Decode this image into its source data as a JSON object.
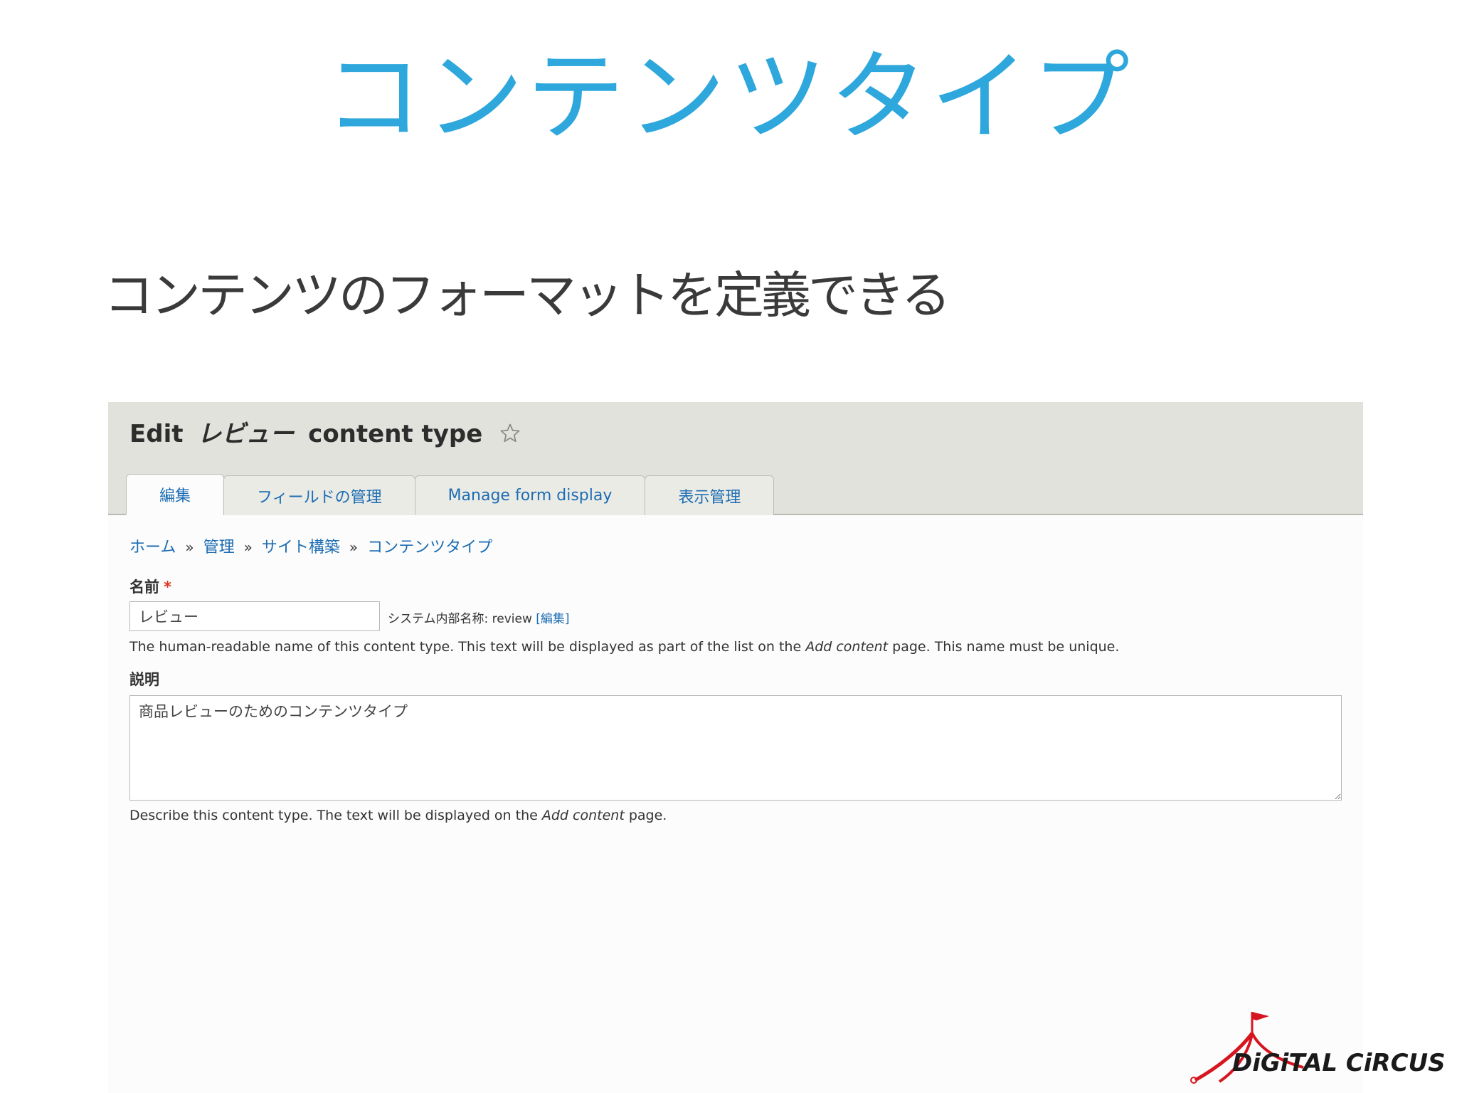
{
  "slide": {
    "title": "コンテンツタイプ",
    "subtitle": "コンテンツのフォーマットを定義できる"
  },
  "screenshot": {
    "page_title_prefix": "Edit",
    "page_title_name": "レビュー",
    "page_title_suffix": "content type",
    "tabs": [
      {
        "label": "編集",
        "active": true
      },
      {
        "label": "フィールドの管理",
        "active": false
      },
      {
        "label": "Manage form display",
        "active": false
      },
      {
        "label": "表示管理",
        "active": false
      }
    ],
    "breadcrumb": [
      "ホーム",
      "管理",
      "サイト構築",
      "コンテンツタイプ"
    ],
    "breadcrumb_separator": "»",
    "name_field": {
      "label": "名前",
      "required_mark": "*",
      "value": "レビュー",
      "machine_name_label": "システム内部名称: review",
      "machine_name_edit_link": "[編集]",
      "help_before": "The human-readable name of this content type. This text will be displayed as part of the list on the",
      "help_emphasis": "Add content",
      "help_after": "page. This name must be unique."
    },
    "description_field": {
      "label": "説明",
      "value": "商品レビューのためのコンテンツタイプ",
      "help_before": "Describe this content type. The text will be displayed on the",
      "help_emphasis": "Add content",
      "help_after": "page."
    }
  },
  "logo": {
    "text": "DiGiTAL CiRCUS",
    "color_red": "#d7151f",
    "color_text": "#1a1a1a"
  },
  "colors": {
    "title_blue": "#2ea7dc",
    "link_blue": "#1d6db3",
    "header_bg": "#e2e2dc"
  }
}
